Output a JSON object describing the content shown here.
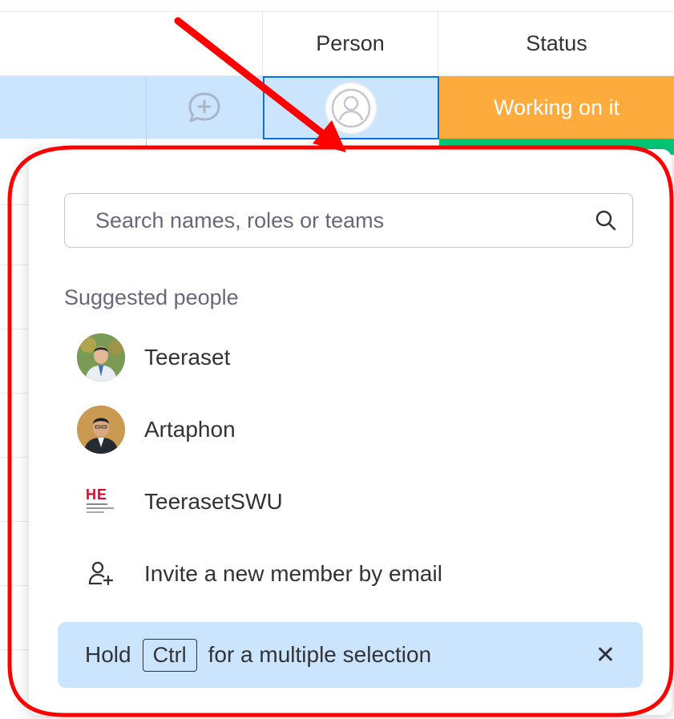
{
  "board": {
    "columns": {
      "person": "Person",
      "status": "Status"
    },
    "status_value": "Working on it",
    "colors": {
      "working": "#fdab3d",
      "done": "#00c875",
      "selected": "#cce5ff",
      "accent": "#0073ea"
    }
  },
  "icons": {
    "comment": "add-comment-icon",
    "person_placeholder": "person-placeholder-icon",
    "search": "search-icon",
    "invite": "invite-member-icon",
    "close": "close-icon"
  },
  "people_picker": {
    "search_placeholder": "Search names, roles or teams",
    "suggested_title": "Suggested people",
    "people": [
      {
        "name": "Teeraset"
      },
      {
        "name": "Artaphon"
      },
      {
        "name": "TeerasetSWU"
      }
    ],
    "invite_label": "Invite a new member by email",
    "hint": {
      "prefix": "Hold",
      "key": "Ctrl",
      "suffix": "for a multiple selection"
    },
    "close_symbol": "✕"
  },
  "annotation_colors": {
    "arrow": "#ff0000",
    "outline": "#ff0000"
  }
}
